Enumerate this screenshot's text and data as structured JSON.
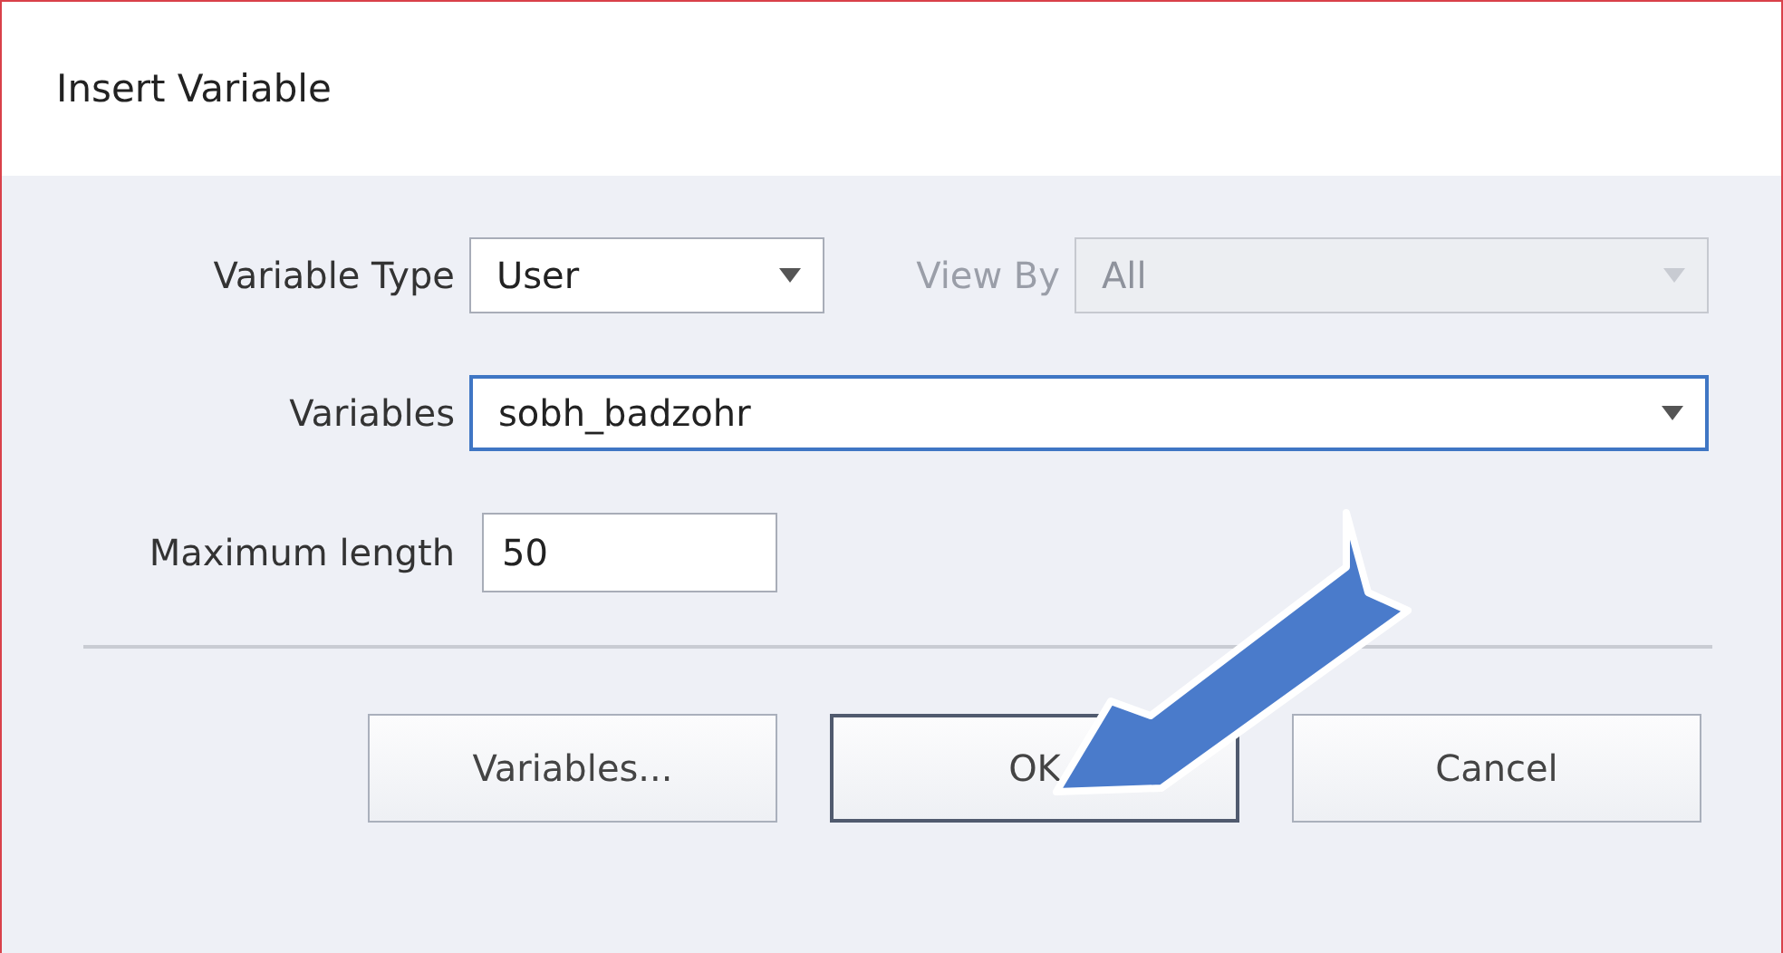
{
  "window": {
    "title": "Insert Variable"
  },
  "variable_type": {
    "label": "Variable Type",
    "value": "User",
    "disabled": false
  },
  "view_by": {
    "label": "View By",
    "value": "All",
    "disabled": true
  },
  "variables": {
    "label": "Variables",
    "value": "sobh_badzohr",
    "focused": true
  },
  "maximum_length": {
    "label": "Maximum length",
    "value": "50"
  },
  "buttons": [
    {
      "label": "Variables...",
      "default": false
    },
    {
      "label": "OK",
      "default": true
    },
    {
      "label": "Cancel",
      "default": false
    }
  ],
  "callout_arrow": {
    "kind": "arrow"
  }
}
